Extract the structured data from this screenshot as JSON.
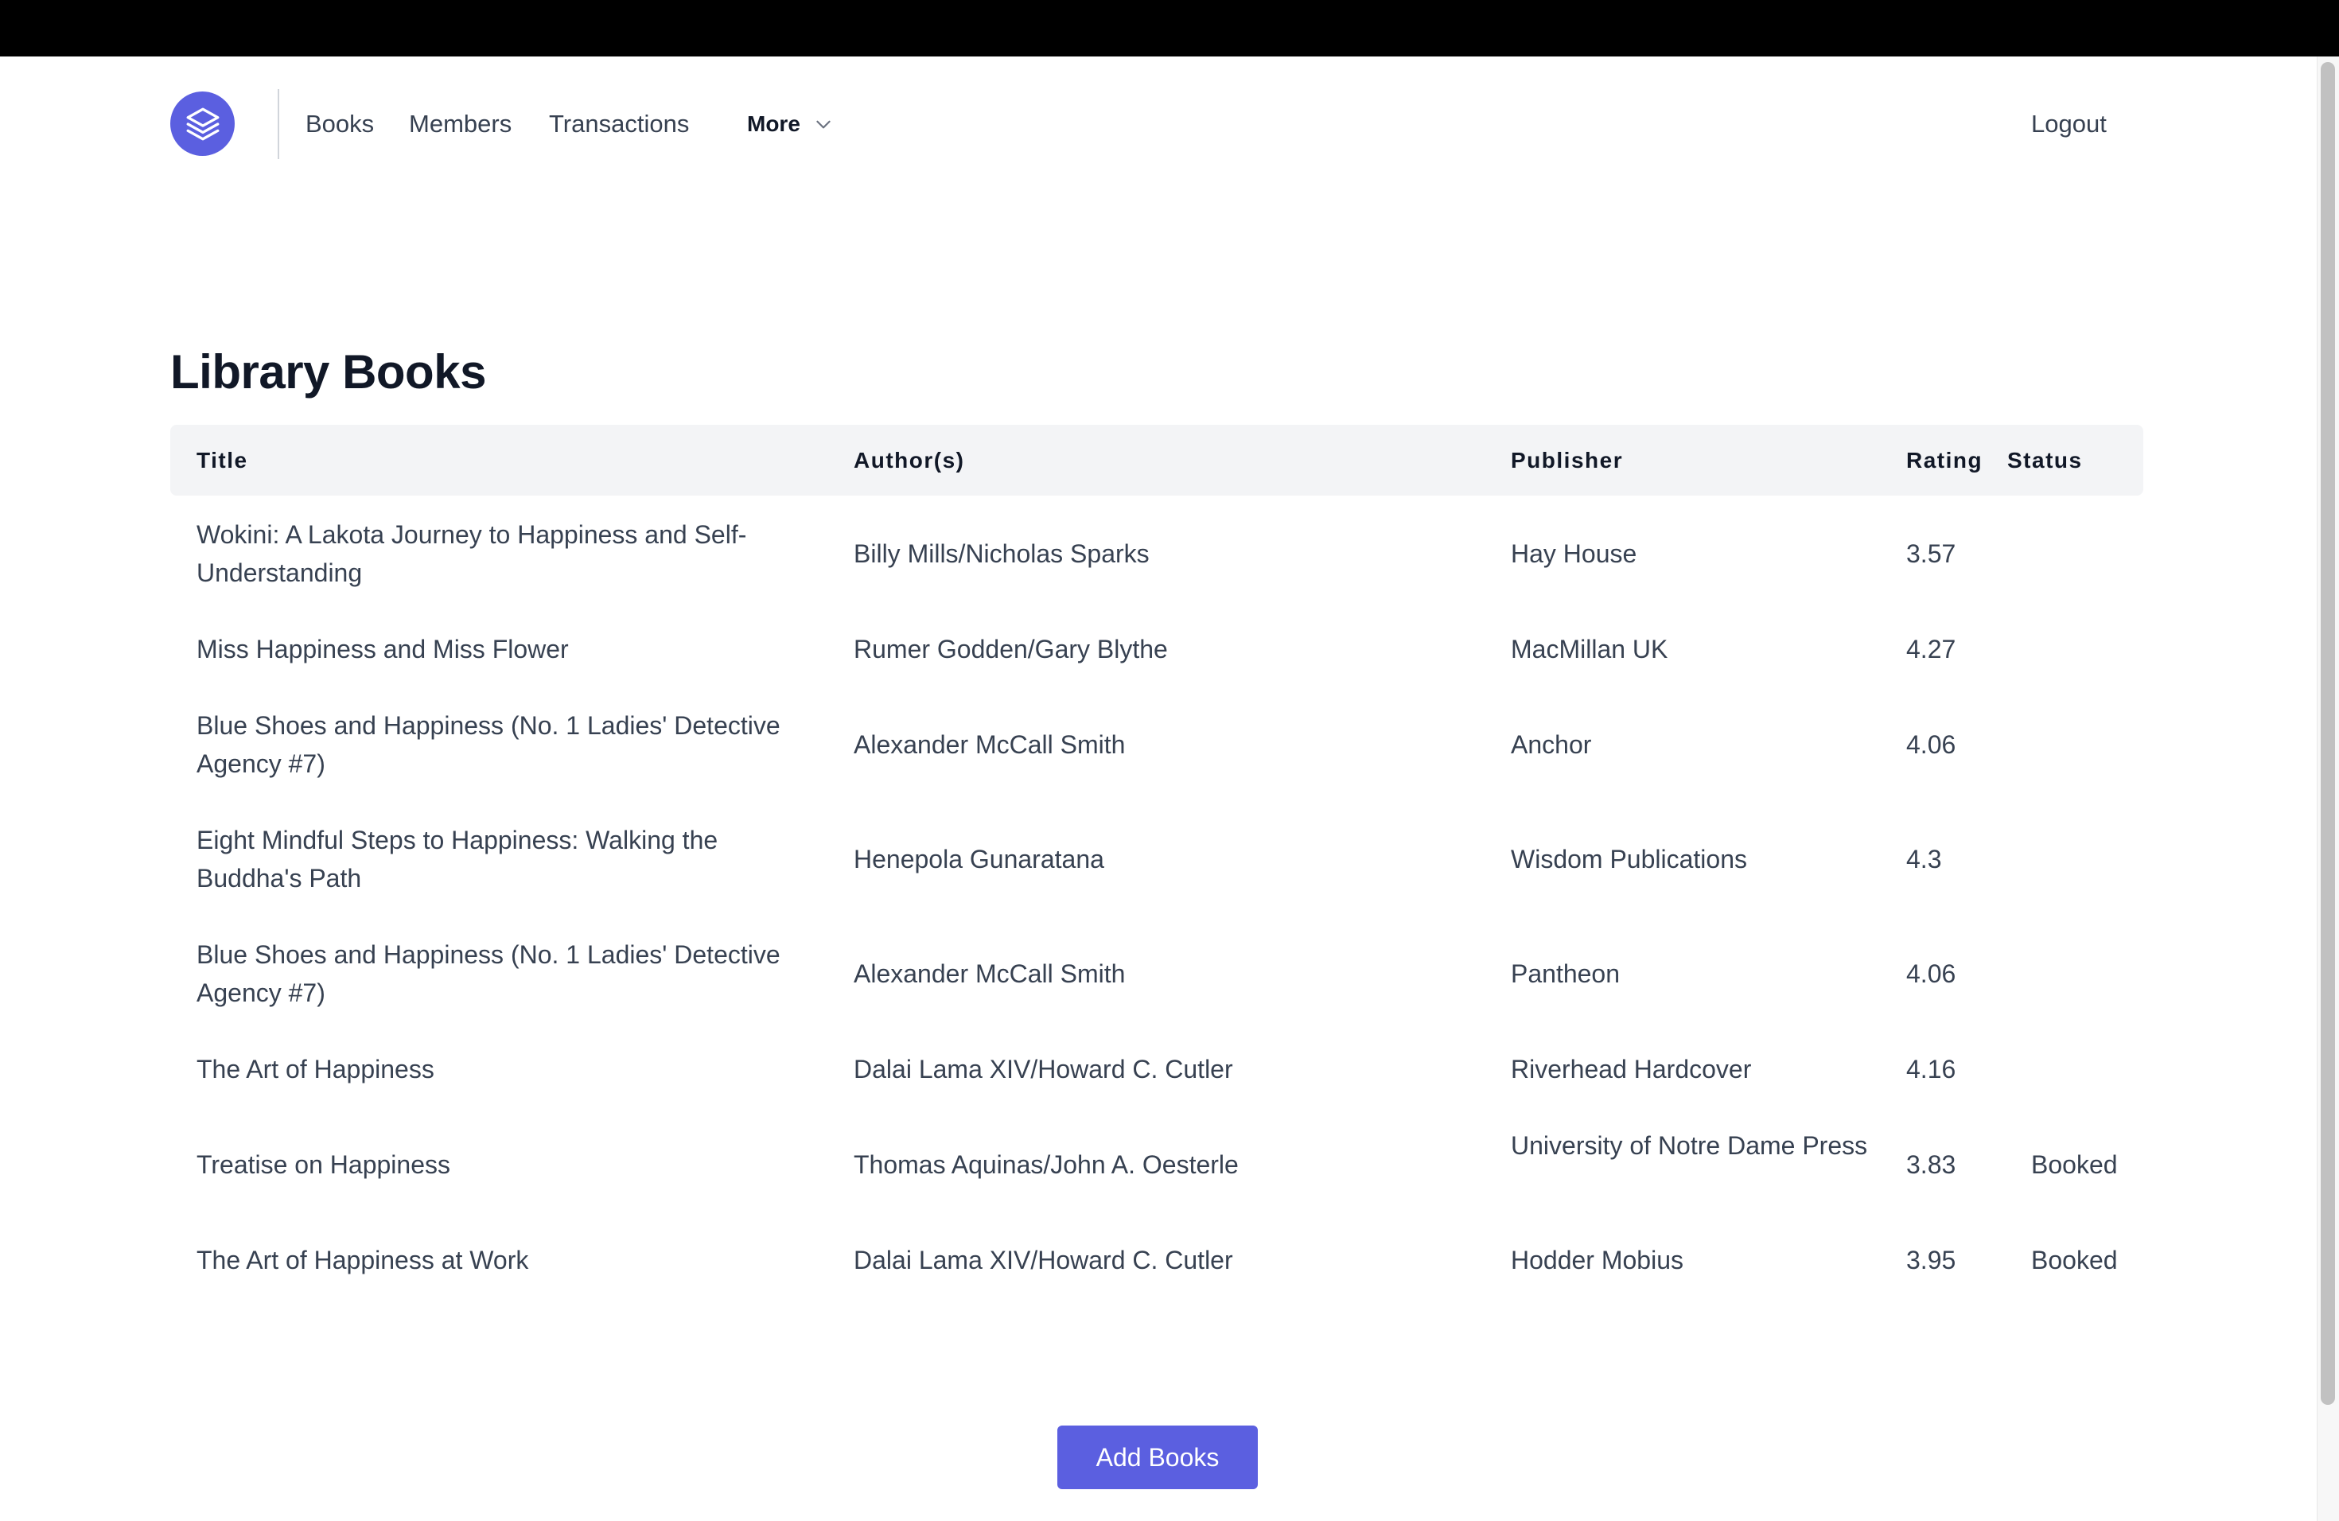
{
  "nav": {
    "logo_icon": "layers-icon",
    "accent_color": "#5b5fe0",
    "books": "Books",
    "members": "Members",
    "transactions": "Transactions",
    "more": "More",
    "more_icon": "chevron-down-icon",
    "logout": "Logout"
  },
  "page": {
    "title": "Library Books"
  },
  "table": {
    "columns": {
      "title": "Title",
      "author": "Author(s)",
      "publisher": "Publisher",
      "rating": "Rating",
      "status": "Status"
    },
    "rows": [
      {
        "title": "Wokini: A Lakota Journey to Happiness and Self-Understanding",
        "author": "Billy Mills/Nicholas Sparks",
        "publisher": "Hay House",
        "rating": "3.57",
        "status": ""
      },
      {
        "title": "Miss Happiness and Miss Flower",
        "author": "Rumer Godden/Gary Blythe",
        "publisher": "MacMillan UK",
        "rating": "4.27",
        "status": ""
      },
      {
        "title": "Blue Shoes and Happiness (No. 1 Ladies' Detective Agency #7)",
        "author": "Alexander McCall Smith",
        "publisher": "Anchor",
        "rating": "4.06",
        "status": ""
      },
      {
        "title": "Eight Mindful Steps to Happiness: Walking the Buddha's Path",
        "author": "Henepola Gunaratana",
        "publisher": "Wisdom Publications",
        "rating": "4.3",
        "status": ""
      },
      {
        "title": "Blue Shoes and Happiness (No. 1 Ladies' Detective Agency #7)",
        "author": "Alexander McCall Smith",
        "publisher": "Pantheon",
        "rating": "4.06",
        "status": ""
      },
      {
        "title": "The Art of Happiness",
        "author": "Dalai Lama XIV/Howard C. Cutler",
        "publisher": "Riverhead Hardcover",
        "rating": "4.16",
        "status": ""
      },
      {
        "title": "Treatise on Happiness",
        "author": "Thomas Aquinas/John A. Oesterle",
        "publisher": "University of Notre Dame Press",
        "rating": "3.83",
        "status": "Booked"
      },
      {
        "title": "The Art of Happiness at Work",
        "author": "Dalai Lama XIV/Howard C. Cutler",
        "publisher": "Hodder Mobius",
        "rating": "3.95",
        "status": "Booked"
      }
    ]
  },
  "actions": {
    "add_books": "Add Books"
  }
}
